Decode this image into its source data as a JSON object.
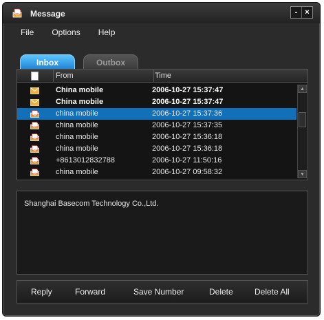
{
  "window": {
    "title": "Message",
    "minimize_label": "-",
    "close_label": "×"
  },
  "menu": {
    "items": [
      "File",
      "Options",
      "Help"
    ]
  },
  "tabs": {
    "inbox": "Inbox",
    "outbox": "Outbox",
    "active": "inbox"
  },
  "list": {
    "columns": {
      "from": "From",
      "time": "Time"
    },
    "rows": [
      {
        "from": "China mobile",
        "time": "2006-10-27 15:37:47",
        "icon": "unread-mail-icon",
        "unread": true,
        "selected": false
      },
      {
        "from": "China mobile",
        "time": "2006-10-27 15:37:47",
        "icon": "unread-mail-icon",
        "unread": true,
        "selected": false
      },
      {
        "from": "china mobile",
        "time": "2006-10-27 15:37:36",
        "icon": "read-mail-icon",
        "unread": false,
        "selected": true
      },
      {
        "from": "china mobile",
        "time": "2006-10-27 15:37:35",
        "icon": "read-mail-icon",
        "unread": false,
        "selected": false
      },
      {
        "from": "china mobile",
        "time": "2006-10-27 15:36:18",
        "icon": "read-mail-icon",
        "unread": false,
        "selected": false
      },
      {
        "from": "china mobile",
        "time": "2006-10-27 15:36:18",
        "icon": "read-mail-icon",
        "unread": false,
        "selected": false
      },
      {
        "from": "+8613012832788",
        "time": "2006-10-27 11:50:16",
        "icon": "read-mail-icon",
        "unread": false,
        "selected": false
      },
      {
        "from": "china mobile",
        "time": "2006-10-27 09:58:32",
        "icon": "read-mail-icon",
        "unread": false,
        "selected": false
      }
    ]
  },
  "preview": {
    "text": "Shanghai Basecom Technology Co.,Ltd."
  },
  "actions": {
    "reply": "Reply",
    "forward": "Forward",
    "save_number": "Save Number",
    "delete": "Delete",
    "delete_all": "Delete All"
  },
  "colors": {
    "background": "#2b2b2b",
    "selection": "#1270b8",
    "active_tab": "#1a7fd0"
  }
}
